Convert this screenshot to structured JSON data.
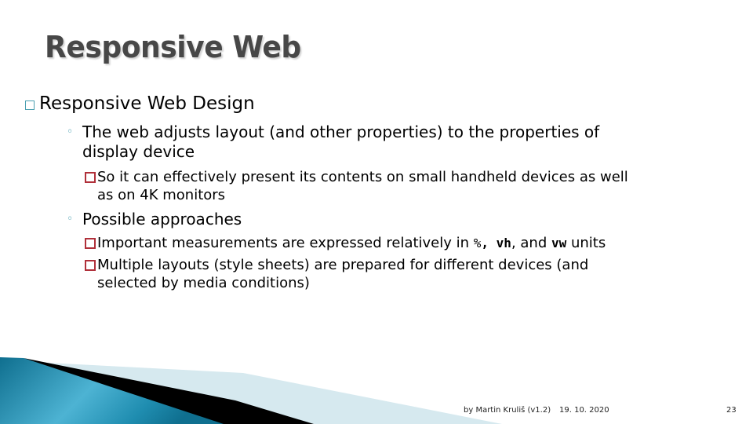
{
  "slide": {
    "title": "Responsive Web",
    "level1": {
      "bullet_icon": "square-outline-bullet",
      "label": "Responsive Web Design"
    },
    "items": [
      {
        "text": "The web adjusts layout (and other properties) to the properties of display device",
        "line1": "The web adjusts layout (and other properties) to the properties of",
        "line2": "display device",
        "sub": [
          {
            "line1": "So it can effectively present its contents on small handheld devices as well",
            "line2": "as on 4K monitors"
          }
        ]
      },
      {
        "text": "Possible approaches",
        "sub": [
          {
            "pre": "Important measurements are expressed relatively in ",
            "unit1": "%",
            "sep1": ", ",
            "unit2": "vh",
            "sep2": ", and ",
            "unit3": "vw",
            "post": " units"
          },
          {
            "line1": "Multiple layouts (style sheets) are prepared for different devices (and",
            "line2": "selected by media conditions)"
          }
        ]
      }
    ]
  },
  "footer": {
    "author": "by Martin Kruliš (v1.2)",
    "date": "19. 10. 2020",
    "page_number": "23"
  },
  "colors": {
    "title": "#474747",
    "accent_teal": "#4a9fb0",
    "bullet_red": "#b0303a",
    "wedge_dark": "#0f6f8f",
    "wedge_light": "#5bbad8",
    "wedge_pale": "#d6e9ef"
  }
}
